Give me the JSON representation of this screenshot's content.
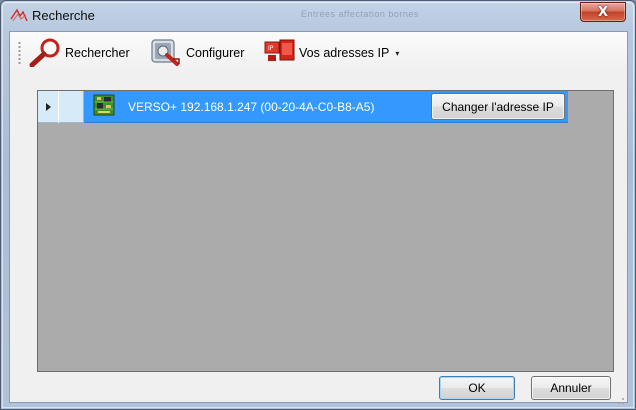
{
  "window": {
    "title": "Recherche",
    "background_ghost_title": "Entrées affectation bornes",
    "close_symbol": "X"
  },
  "toolbar": {
    "search_label": "Rechercher",
    "search_icon": "magnifier-icon",
    "configure_label": "Configurer",
    "configure_icon": "device-config-icon",
    "ip_label": "Vos adresses IP",
    "ip_icon": "ip-network-icon",
    "ip_dropdown_symbol": "▾"
  },
  "grid": {
    "rows": [
      {
        "device_icon": "circuit-board-icon",
        "description": "VERSO+ 192.168.1.247 (00-20-4A-C0-B8-A5)",
        "action_label": "Changer l'adresse IP",
        "selected": true
      }
    ]
  },
  "footer": {
    "ok_label": "OK",
    "cancel_label": "Annuler"
  },
  "colors": {
    "selection": "#3399ff",
    "grid_background": "#ababab",
    "close_button": "#c24128"
  }
}
